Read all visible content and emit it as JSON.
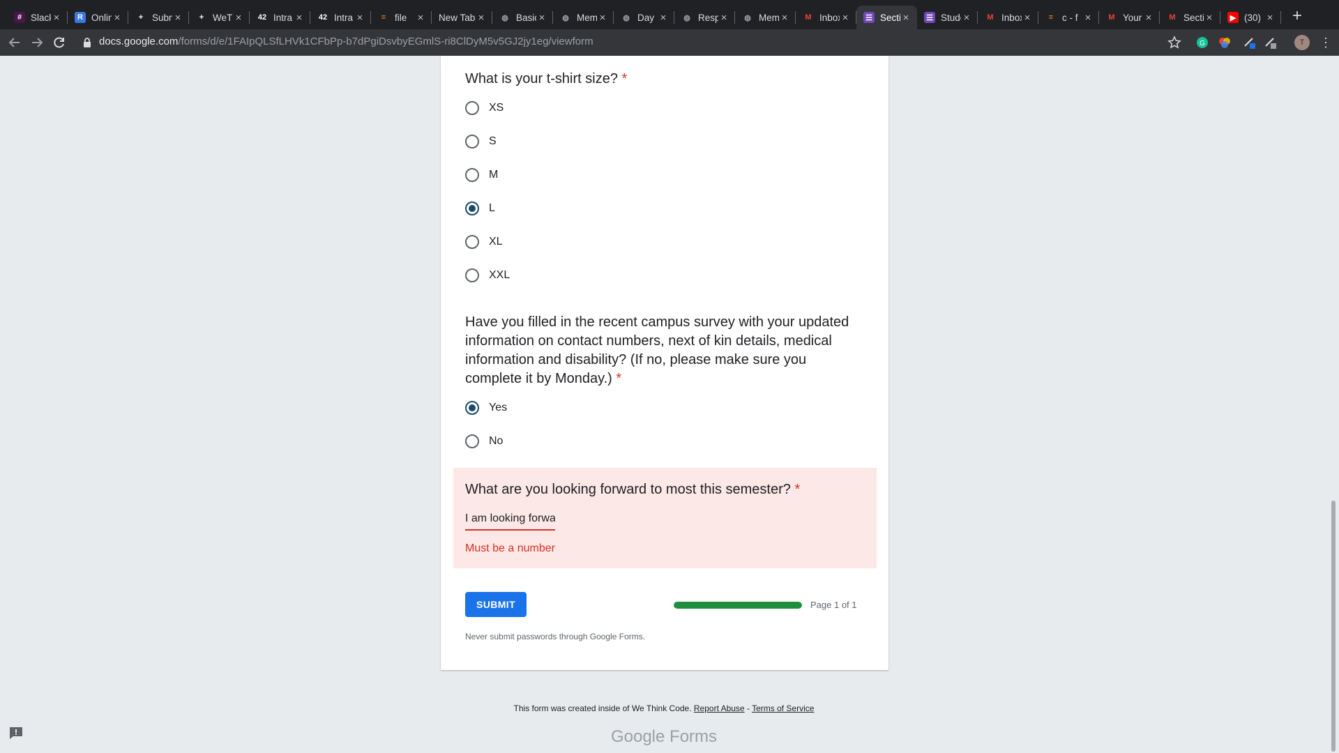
{
  "browser": {
    "tabs": [
      {
        "title": "Slack",
        "icon": "slack-icon",
        "color": "#4a154b",
        "glyph": "#"
      },
      {
        "title": "Online",
        "icon": "r-icon",
        "color": "#3b78e7",
        "glyph": "R"
      },
      {
        "title": "Submit",
        "icon": "plus-icon",
        "color": "#202124",
        "glyph": "+"
      },
      {
        "title": "WeThink",
        "icon": "plus-icon",
        "color": "#202124",
        "glyph": "+"
      },
      {
        "title": "Intra",
        "icon": "42-icon",
        "color": "#202124",
        "glyph": "42"
      },
      {
        "title": "Intra",
        "icon": "42-icon",
        "color": "#202124",
        "glyph": "42"
      },
      {
        "title": "file",
        "icon": "stack-icon",
        "color": "#f48024",
        "glyph": "≡"
      },
      {
        "title": "New Tab",
        "icon": "",
        "color": "",
        "glyph": ""
      },
      {
        "title": "Basic",
        "icon": "globe-icon",
        "color": "#5f6368",
        "glyph": "◍"
      },
      {
        "title": "Memory",
        "icon": "globe-icon",
        "color": "#5f6368",
        "glyph": "◍"
      },
      {
        "title": "Day",
        "icon": "globe-icon",
        "color": "#5f6368",
        "glyph": "◍"
      },
      {
        "title": "Response",
        "icon": "globe-icon",
        "color": "#5f6368",
        "glyph": "◍"
      },
      {
        "title": "Memory",
        "icon": "globe-icon",
        "color": "#5f6368",
        "glyph": "◍"
      },
      {
        "title": "Inbox",
        "icon": "gmail-icon",
        "color": "#ffffff",
        "glyph": "M"
      },
      {
        "title": "Section",
        "icon": "forms-icon",
        "color": "#7248b9",
        "glyph": "☰",
        "active": true
      },
      {
        "title": "Student",
        "icon": "forms-icon",
        "color": "#7248b9",
        "glyph": "☰"
      },
      {
        "title": "Inbox",
        "icon": "gmail-icon",
        "color": "#ffffff",
        "glyph": "M"
      },
      {
        "title": "c - f",
        "icon": "stack-icon",
        "color": "#f48024",
        "glyph": "≡"
      },
      {
        "title": "Your",
        "icon": "gmail-icon",
        "color": "#ffffff",
        "glyph": "M"
      },
      {
        "title": "Section",
        "icon": "gmail-icon",
        "color": "#ffffff",
        "glyph": "M"
      },
      {
        "title": "(30)",
        "icon": "youtube-icon",
        "color": "#ff0000",
        "glyph": "▶"
      }
    ],
    "url_host": "docs.google.com",
    "url_path": "/forms/d/e/1FAIpQLSfLHVk1CFbPp-b7dPgiDsvbyEGmlS-ri8ClDyM5v5GJ2jy1eg/viewform",
    "profile_initial": "T"
  },
  "form": {
    "q_tshirt": {
      "title": "What is your t-shirt size?",
      "required_mark": "*",
      "options": [
        {
          "label": "XS",
          "checked": false
        },
        {
          "label": "S",
          "checked": false
        },
        {
          "label": "M",
          "checked": false
        },
        {
          "label": "L",
          "checked": true
        },
        {
          "label": "XL",
          "checked": false
        },
        {
          "label": "XXL",
          "checked": false
        }
      ]
    },
    "q_survey": {
      "title_lines": [
        "Have you filled in the recent campus survey with your updated",
        "information on contact numbers, next of kin details, medical",
        "information and disability? (If no, please make sure you",
        "complete it by Monday.)"
      ],
      "required_mark": "*",
      "options": [
        {
          "label": "Yes",
          "checked": true
        },
        {
          "label": "No",
          "checked": false
        }
      ]
    },
    "q_semester": {
      "title": "What are you looking forward to most this semester?",
      "required_mark": "*",
      "answer": "I am looking forwa",
      "error": "Must be a number"
    },
    "submit_label": "SUBMIT",
    "progress": 1.0,
    "page_label": "Page 1 of 1",
    "password_warning": "Never submit passwords through Google Forms."
  },
  "footer": {
    "created_text": "This form was created inside of We Think Code.",
    "report_abuse": "Report Abuse",
    "separator": "-",
    "terms": "Terms of Service",
    "brand_google": "Google",
    "brand_forms": "Forms"
  },
  "colors": {
    "accent": "#1a73e8",
    "radio_checked": "#1a4a6b",
    "error": "#d93025",
    "error_bg": "#fce8e6",
    "progress": "#1e8e3e"
  }
}
